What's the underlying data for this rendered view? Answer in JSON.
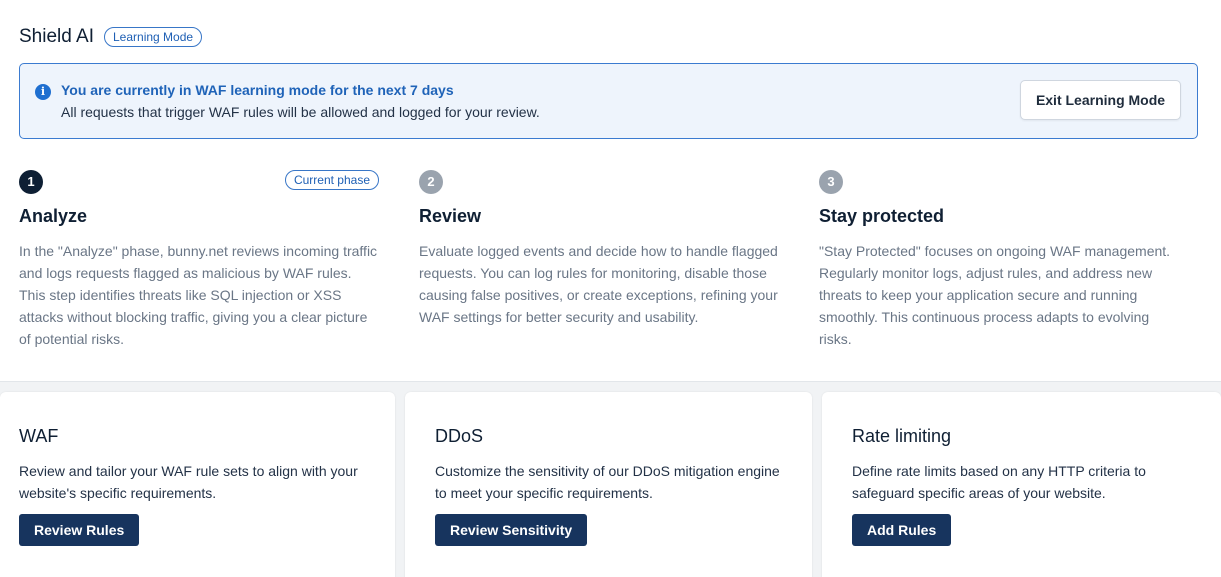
{
  "header": {
    "title": "Shield AI",
    "mode_badge": "Learning Mode"
  },
  "banner": {
    "icon": "info-icon",
    "title": "You are currently in WAF learning mode for the next 7 days",
    "text": "All requests that trigger WAF rules will be allowed and logged for your review.",
    "button": "Exit Learning Mode"
  },
  "phases": [
    {
      "number": "1",
      "badge": "Current phase",
      "title": "Analyze",
      "description": "In the \"Analyze\" phase, bunny.net reviews incoming traffic and logs requests flagged as malicious by WAF rules. This step identifies threats like SQL injection or XSS attacks without blocking traffic, giving you a clear picture of potential risks."
    },
    {
      "number": "2",
      "title": "Review",
      "description": "Evaluate logged events and decide how to handle flagged requests. You can log rules for monitoring, disable those causing false positives, or create exceptions, refining your WAF settings for better security and usability."
    },
    {
      "number": "3",
      "title": "Stay protected",
      "description": "\"Stay Protected\" focuses on ongoing WAF management. Regularly monitor logs, adjust rules, and address new threats to keep your application secure and running smoothly. This continuous process adapts to evolving risks."
    }
  ],
  "cards": [
    {
      "title": "WAF",
      "description": "Review and tailor your WAF rule sets to align with your website's specific requirements.",
      "button": "Review Rules"
    },
    {
      "title": "DDoS",
      "description": "Customize the sensitivity of our DDoS mitigation engine to meet your specific requirements.",
      "button": "Review Sensitivity"
    },
    {
      "title": "Rate limiting",
      "description": "Define rate limits based on any HTTP criteria to safeguard specific areas of your website.",
      "button": "Add Rules"
    }
  ],
  "colors": {
    "accent": "#1f6fd0",
    "primary_button": "#17345e",
    "banner_bg": "#eef4fc"
  }
}
